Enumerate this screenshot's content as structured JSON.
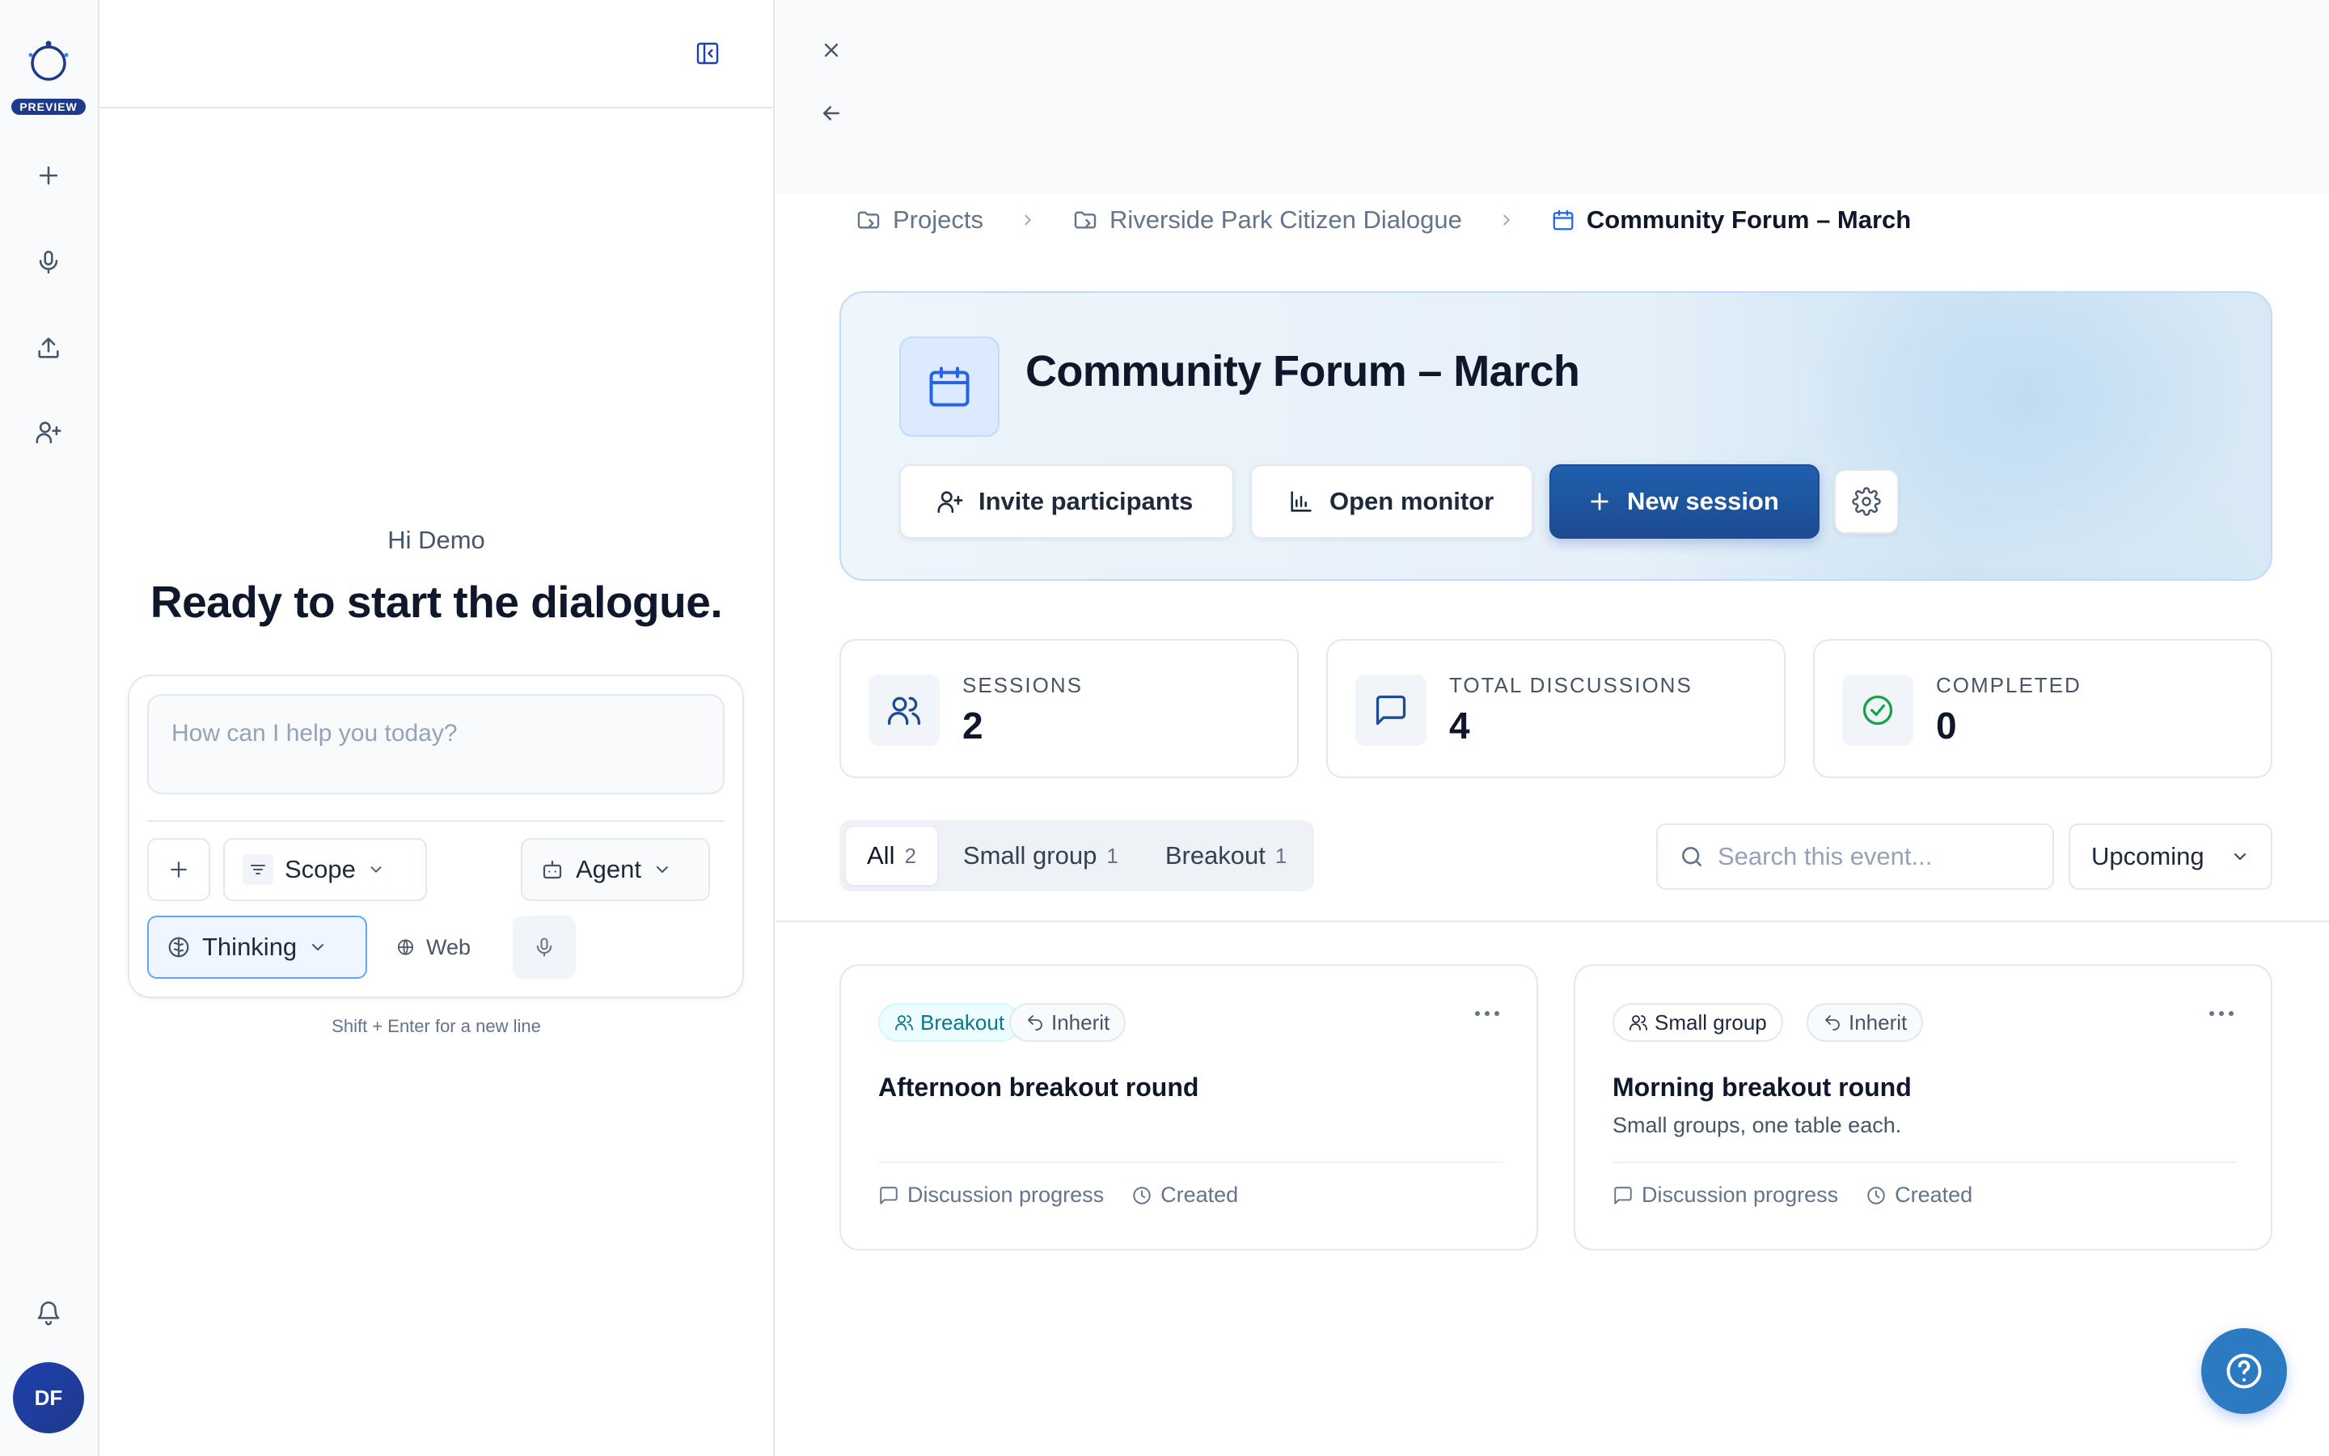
{
  "rail": {
    "badge": "PREVIEW",
    "avatar_initials": "DF",
    "icons": [
      "logo-icon",
      "plus-icon",
      "mic-icon",
      "upload-icon",
      "user-plus-icon",
      "bell-icon"
    ]
  },
  "chat": {
    "greeting": "Hi Demo",
    "title": "Ready to start the dialogue.",
    "prompt_placeholder": "How can I help you today?",
    "scope_label": "Scope",
    "agent_label": "Agent",
    "thinking_label": "Thinking",
    "web_label": "Web",
    "hint": "Shift + Enter for a new line"
  },
  "breadcrumb": {
    "items": [
      "Projects",
      "Riverside Park Citizen Dialogue",
      "Community Forum – March"
    ]
  },
  "hero": {
    "title": "Community Forum – March",
    "invite_label": "Invite participants",
    "monitor_label": "Open monitor",
    "new_session_label": "New session"
  },
  "stats": [
    {
      "label": "SESSIONS",
      "value": "2"
    },
    {
      "label": "TOTAL DISCUSSIONS",
      "value": "4"
    },
    {
      "label": "COMPLETED",
      "value": "0"
    }
  ],
  "tabs": [
    {
      "label": "All",
      "count": "2",
      "active": true
    },
    {
      "label": "Small group",
      "count": "1",
      "active": false
    },
    {
      "label": "Breakout",
      "count": "1",
      "active": false
    }
  ],
  "search": {
    "placeholder": "Search this event..."
  },
  "filter": {
    "selected": "Upcoming"
  },
  "cards": [
    {
      "type_chip": "Breakout",
      "inherit_chip": "Inherit",
      "title": "Afternoon breakout round",
      "subtitle": "",
      "meta_progress": "Discussion progress",
      "meta_created": "Created"
    },
    {
      "type_chip": "Small group",
      "inherit_chip": "Inherit",
      "title": "Morning breakout round",
      "subtitle": "Small groups, one table each.",
      "meta_progress": "Discussion progress",
      "meta_created": "Created"
    }
  ],
  "colors": {
    "primary": "#1e4b91",
    "accent_blue": "#2563eb",
    "breakout_teal": "#0e7490",
    "completed_green": "#16a34a",
    "help_button": "#2b7ac2"
  }
}
